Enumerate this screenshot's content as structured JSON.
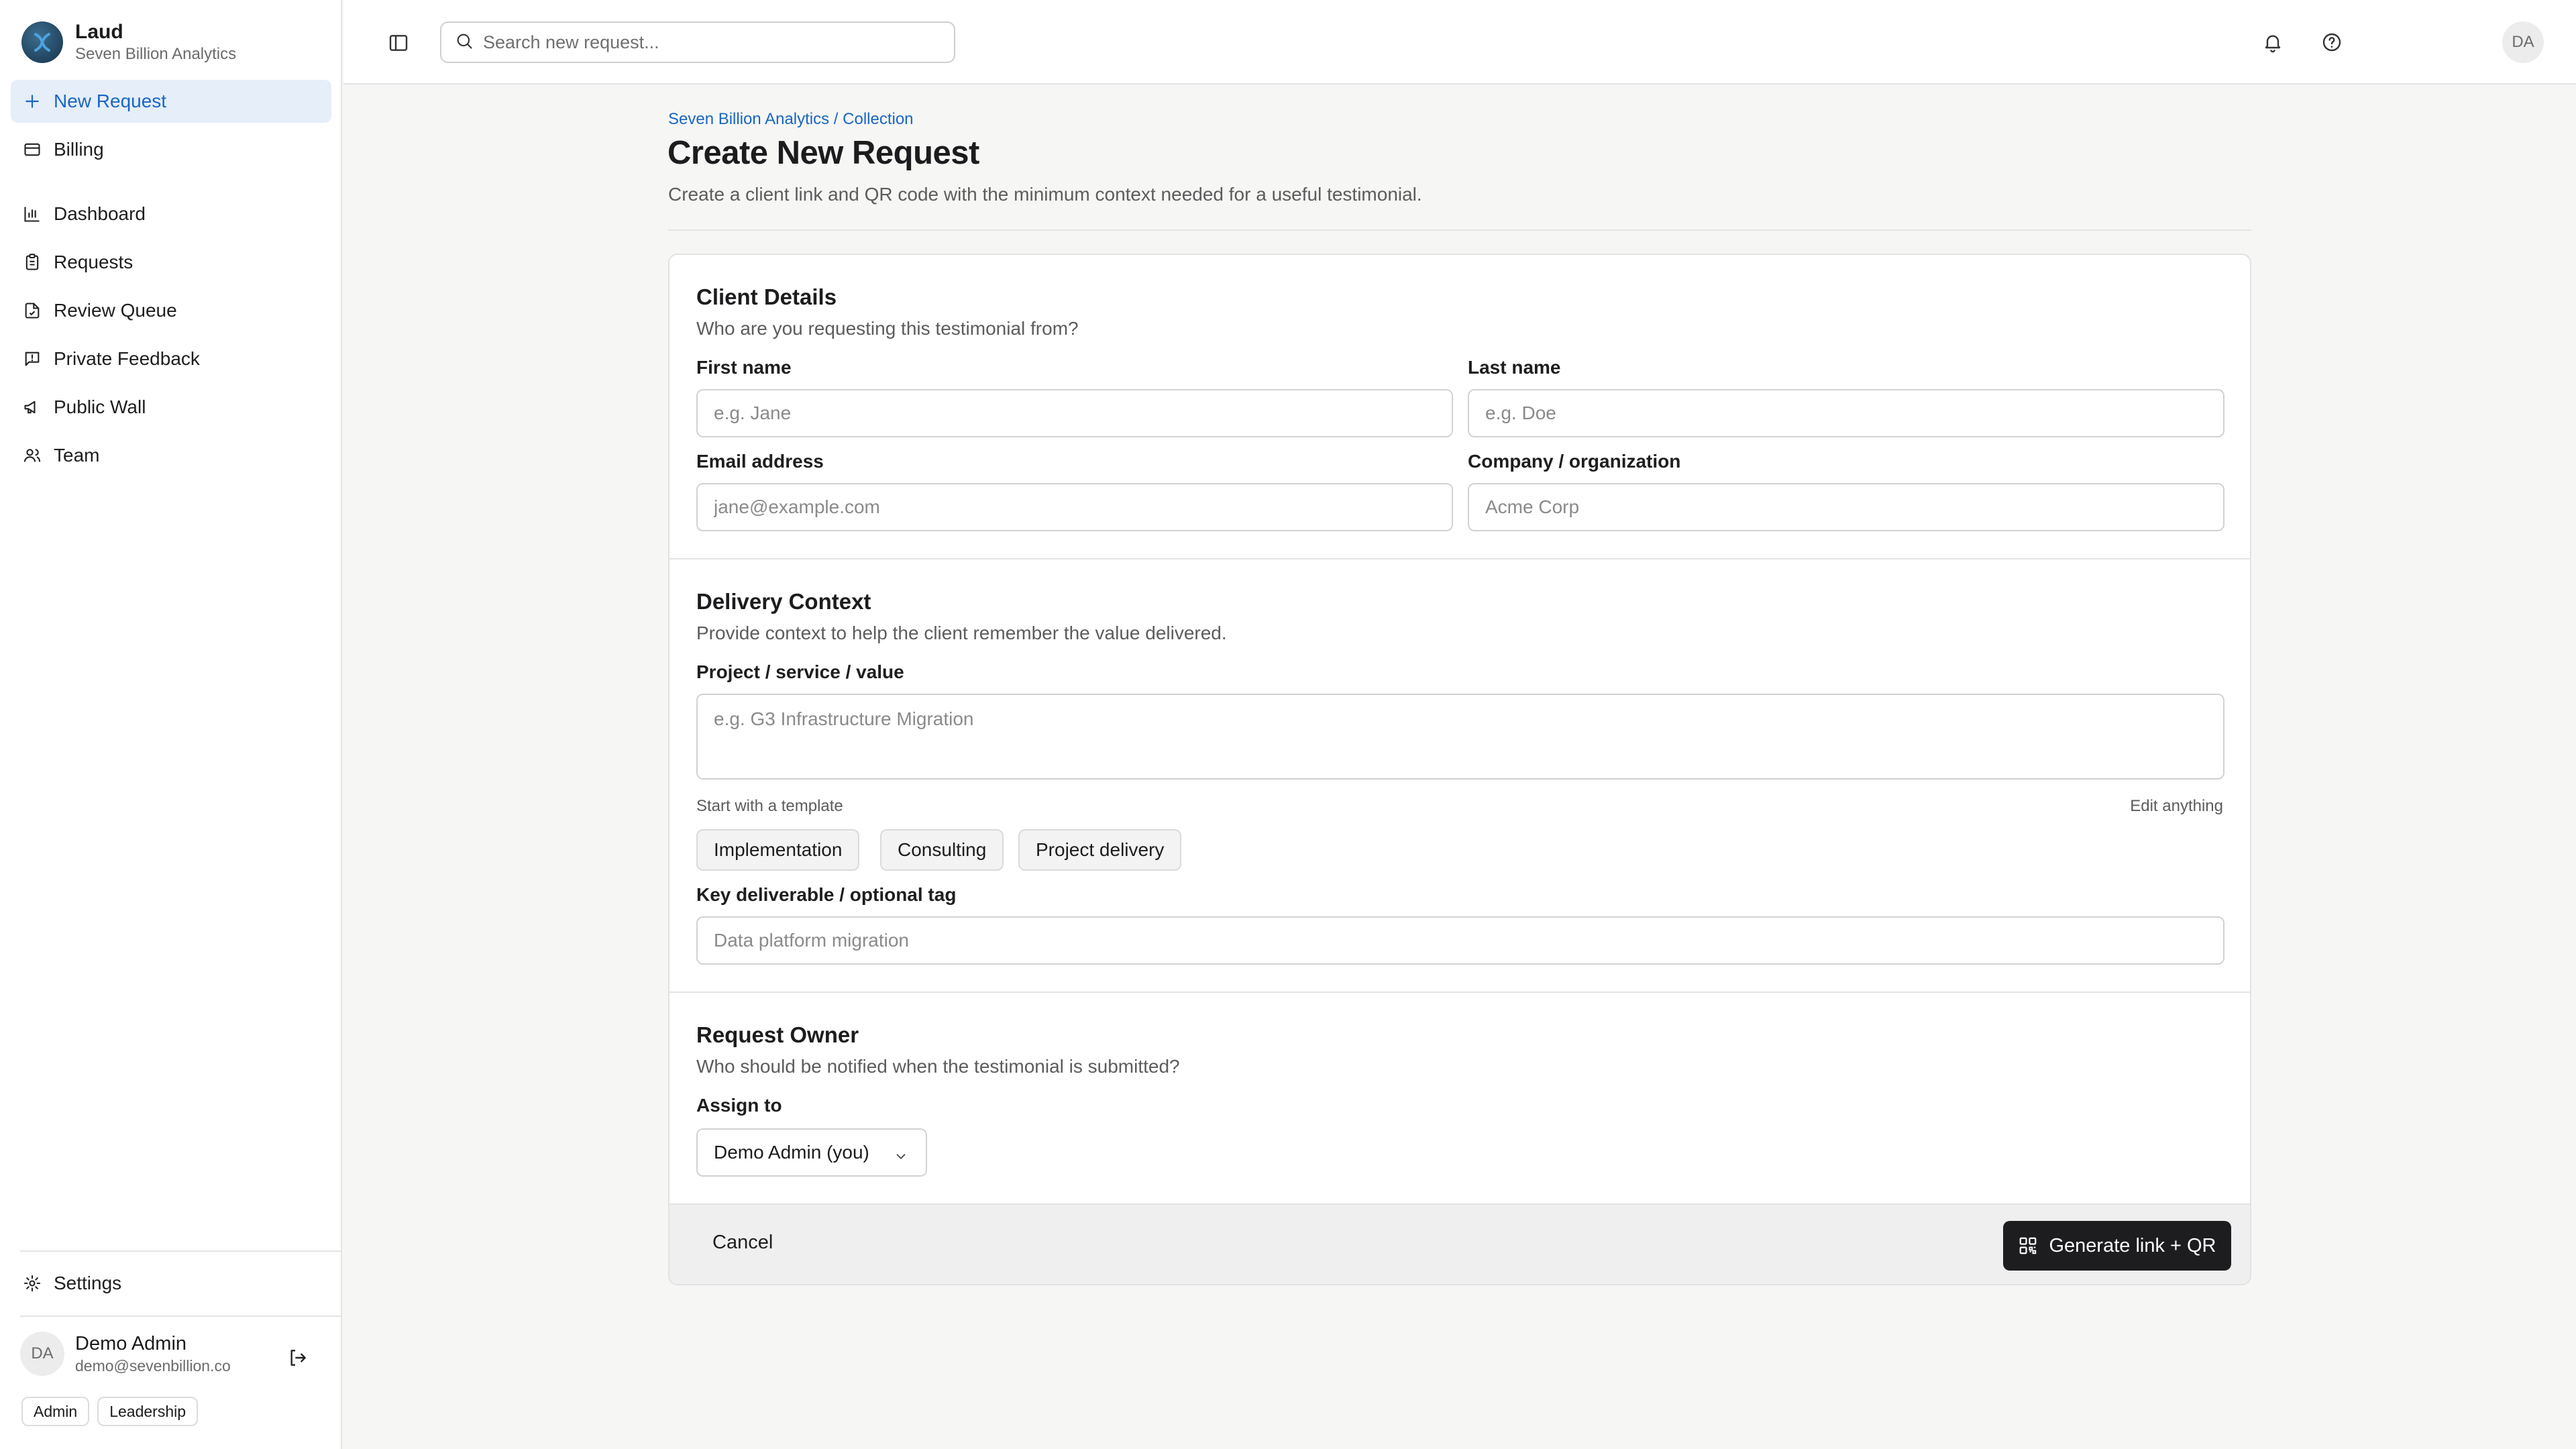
{
  "brand": {
    "name": "Laud",
    "org": "Seven Billion Analytics"
  },
  "sidebar": {
    "items": [
      {
        "label": "New Request",
        "icon": "plus-icon"
      },
      {
        "label": "Billing",
        "icon": "credit-card-icon"
      },
      {
        "label": "Dashboard",
        "icon": "bar-chart-icon"
      },
      {
        "label": "Requests",
        "icon": "clipboard-icon"
      },
      {
        "label": "Review Queue",
        "icon": "file-check-icon"
      },
      {
        "label": "Private Feedback",
        "icon": "message-alert-icon"
      },
      {
        "label": "Public Wall",
        "icon": "megaphone-icon"
      },
      {
        "label": "Team",
        "icon": "users-icon"
      }
    ],
    "settings_label": "Settings"
  },
  "user": {
    "initials": "DA",
    "name": "Demo Admin",
    "email": "demo@sevenbillion.co",
    "tags": [
      "Admin",
      "Leadership"
    ]
  },
  "topbar": {
    "search_placeholder": "Search new request...",
    "avatar_initials": "DA"
  },
  "page": {
    "breadcrumb": "Seven Billion Analytics / Collection",
    "title": "Create New Request",
    "subtitle": "Create a client link and QR code with the minimum context needed for a useful testimonial."
  },
  "client_details": {
    "title": "Client Details",
    "subtitle": "Who are you requesting this testimonial from?",
    "first_name_label": "First name",
    "first_name_placeholder": "e.g. Jane",
    "last_name_label": "Last name",
    "last_name_placeholder": "e.g. Doe",
    "email_label": "Email address",
    "email_placeholder": "jane@example.com",
    "company_label": "Company / organization",
    "company_placeholder": "Acme Corp"
  },
  "delivery_context": {
    "title": "Delivery Context",
    "subtitle": "Provide context to help the client remember the value delivered.",
    "project_label": "Project / service / value",
    "project_placeholder": "e.g. G3 Infrastructure Migration",
    "template_hint": "Start with a template",
    "edit_hint": "Edit anything",
    "templates": [
      "Implementation",
      "Consulting",
      "Project delivery"
    ],
    "deliverable_label": "Key deliverable / optional tag",
    "deliverable_placeholder": "Data platform migration"
  },
  "request_owner": {
    "title": "Request Owner",
    "subtitle": "Who should be notified when the testimonial is submitted?",
    "assign_label": "Assign to",
    "assign_value": "Demo Admin (you)"
  },
  "footer": {
    "cancel_label": "Cancel",
    "generate_label": "Generate link + QR"
  },
  "colors": {
    "accent": "#1a66c4",
    "active_bg": "#e5eef9",
    "primary_button": "#1d1d1f"
  }
}
